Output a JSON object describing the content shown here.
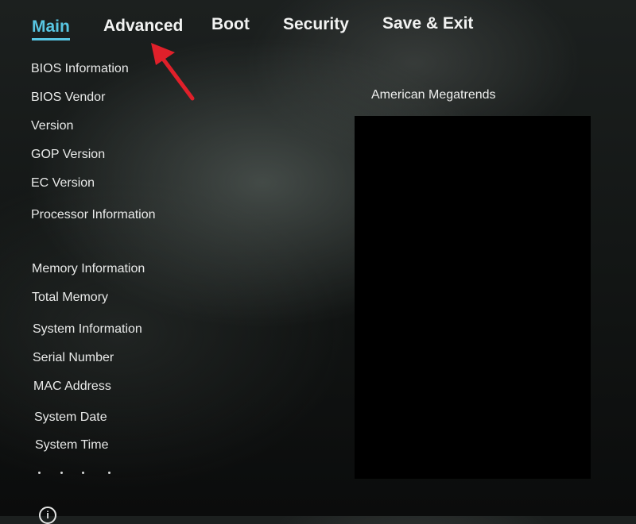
{
  "tabs": [
    {
      "label": "Main",
      "active": true
    },
    {
      "label": "Advanced",
      "active": false
    },
    {
      "label": "Boot",
      "active": false
    },
    {
      "label": "Security",
      "active": false
    },
    {
      "label": "Save & Exit",
      "active": false
    }
  ],
  "main": {
    "bios_information": "BIOS Information",
    "bios_vendor": "BIOS Vendor",
    "version": "Version",
    "gop_version": "GOP Version",
    "ec_version": "EC Version",
    "processor_information": "Processor Information",
    "memory_information": "Memory Information",
    "total_memory": "Total Memory",
    "system_information": "System Information",
    "serial_number": "Serial Number",
    "mac_address": "MAC Address",
    "system_date": "System Date",
    "system_time": "System Time"
  },
  "values": {
    "bios_vendor": "American Megatrends"
  },
  "icons": {
    "info": "info-circle-icon",
    "info_glyph": "i",
    "annotation": "red-arrow-icon"
  },
  "colors": {
    "active_tab": "#58c6e3",
    "annotation": "#e0202a",
    "text": "#e9eae9",
    "redaction": "#000000"
  }
}
